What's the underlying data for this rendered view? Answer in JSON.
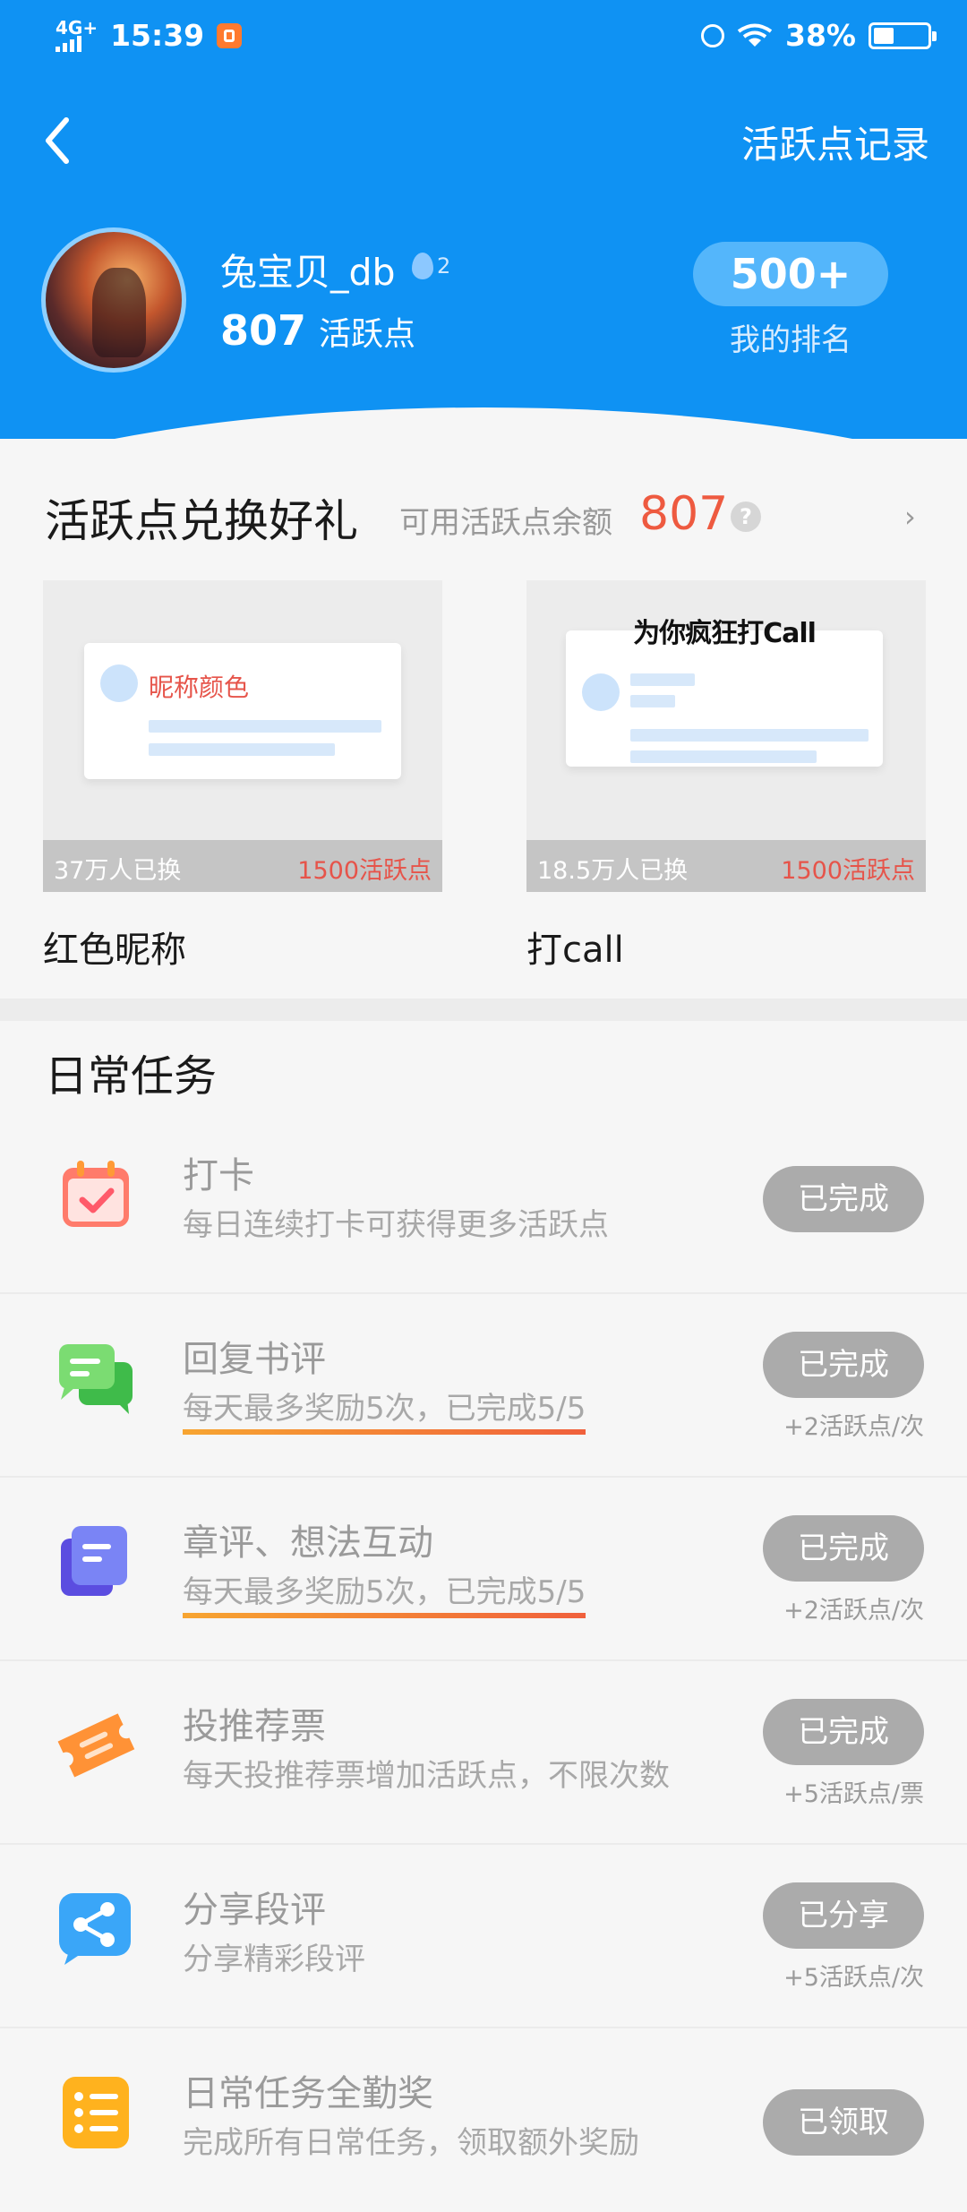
{
  "status_bar": {
    "network": "4G+",
    "time": "15:39",
    "battery": "38%",
    "battery_level": 0.38
  },
  "header": {
    "records_link": "活跃点记录",
    "username": "兔宝贝_db",
    "level": "2",
    "points": "807",
    "points_unit": "活跃点",
    "rank": "500+",
    "rank_label": "我的排名"
  },
  "exchange": {
    "title": "活跃点兑换好礼",
    "balance_label": "可用活跃点余额",
    "balance": "807",
    "help": "?",
    "chevron": "›",
    "gifts": [
      {
        "name": "红色昵称",
        "count": "37万人已换",
        "price": "1500活跃点",
        "preview_text": "昵称颜色"
      },
      {
        "name": "打call",
        "count": "18.5万人已换",
        "price": "1500活跃点",
        "banner_text": "为你疯狂打Call"
      }
    ]
  },
  "tasks": {
    "title": "日常任务",
    "items": [
      {
        "name": "打卡",
        "desc": "每日连续打卡可获得更多活跃点",
        "button": "已完成",
        "reward": "",
        "icon": "calendar-check-icon",
        "color": "#ff7b6b"
      },
      {
        "name": "回复书评",
        "desc": "每天最多奖励5次，已完成5/5",
        "button": "已完成",
        "reward": "+2活跃点/次",
        "icon": "chat-bubbles-icon",
        "color": "#4cc558"
      },
      {
        "name": "章评、想法互动",
        "desc": "每天最多奖励5次，已完成5/5",
        "button": "已完成",
        "reward": "+2活跃点/次",
        "icon": "notes-icon",
        "color": "#6a6cf2"
      },
      {
        "name": "投推荐票",
        "desc": "每天投推荐票增加活跃点，不限次数",
        "button": "已完成",
        "reward": "+5活跃点/票",
        "icon": "ticket-icon",
        "color": "#ff9a36"
      },
      {
        "name": "分享段评",
        "desc": "分享精彩段评",
        "button": "已分享",
        "reward": "+5活跃点/次",
        "icon": "share-icon",
        "color": "#3aa6f8"
      },
      {
        "name": "日常任务全勤奖",
        "desc": "完成所有日常任务，领取额外奖励",
        "button": "已领取",
        "reward": "",
        "icon": "list-icon",
        "color": "#ffb21e"
      }
    ]
  }
}
